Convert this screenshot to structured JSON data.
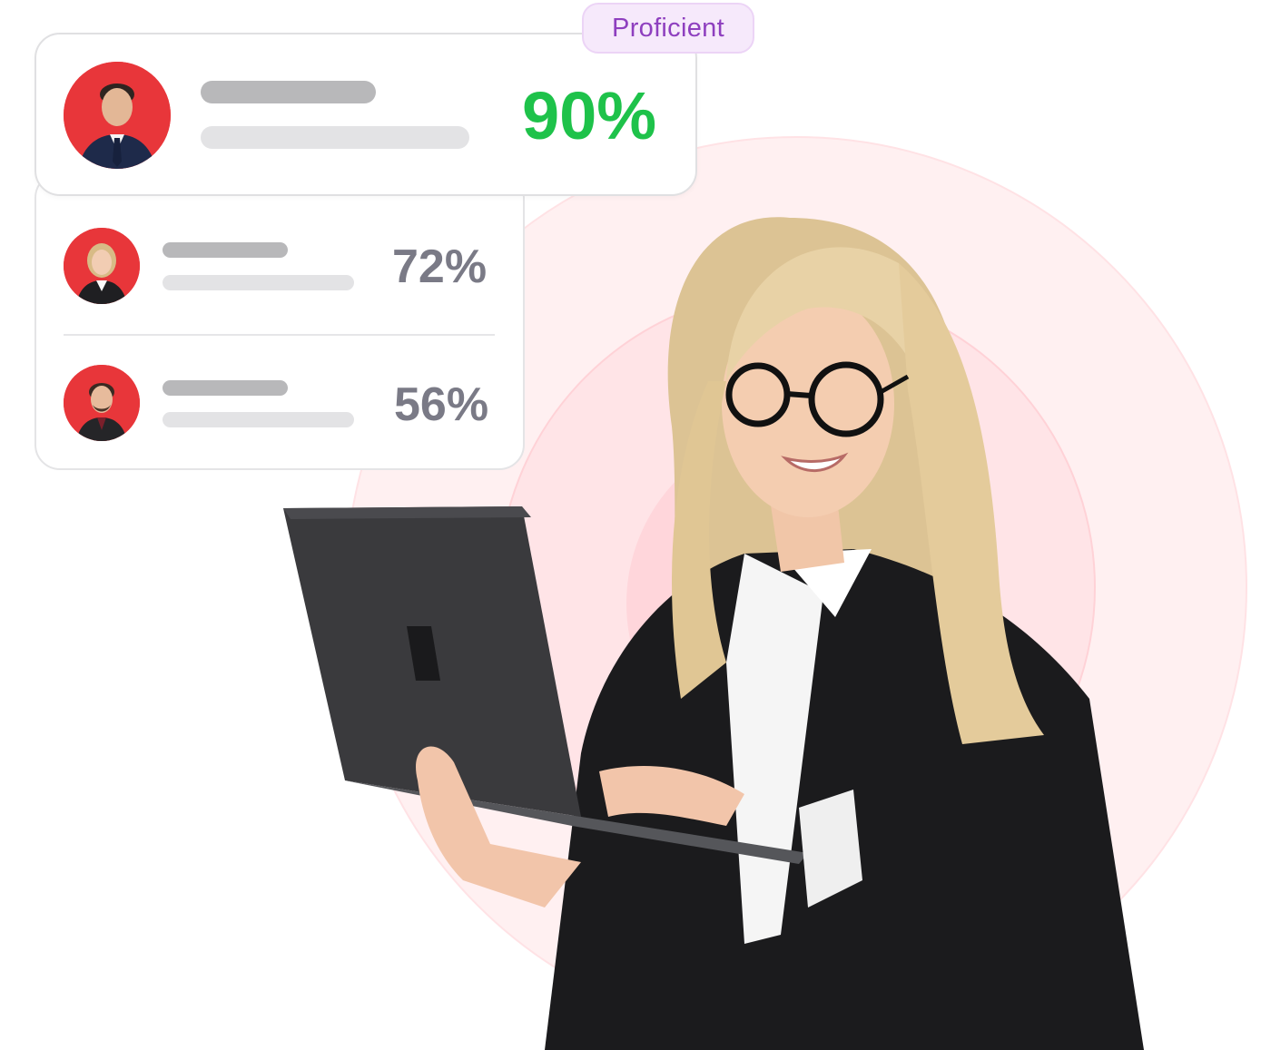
{
  "badge": {
    "label": "Proficient",
    "bg": "#f6e9fb",
    "color": "#8e3fbf"
  },
  "candidates": [
    {
      "score": "90%",
      "score_color": "#1ec24a",
      "avatar": "man-suit-avatar"
    },
    {
      "score": "72%",
      "score_color": "#7a7a86",
      "avatar": "woman-blonde-avatar"
    },
    {
      "score": "56%",
      "score_color": "#7a7a86",
      "avatar": "man-beard-avatar"
    }
  ],
  "colors": {
    "avatar_bg": "#e8363a",
    "halo": "#ffe4e7"
  }
}
